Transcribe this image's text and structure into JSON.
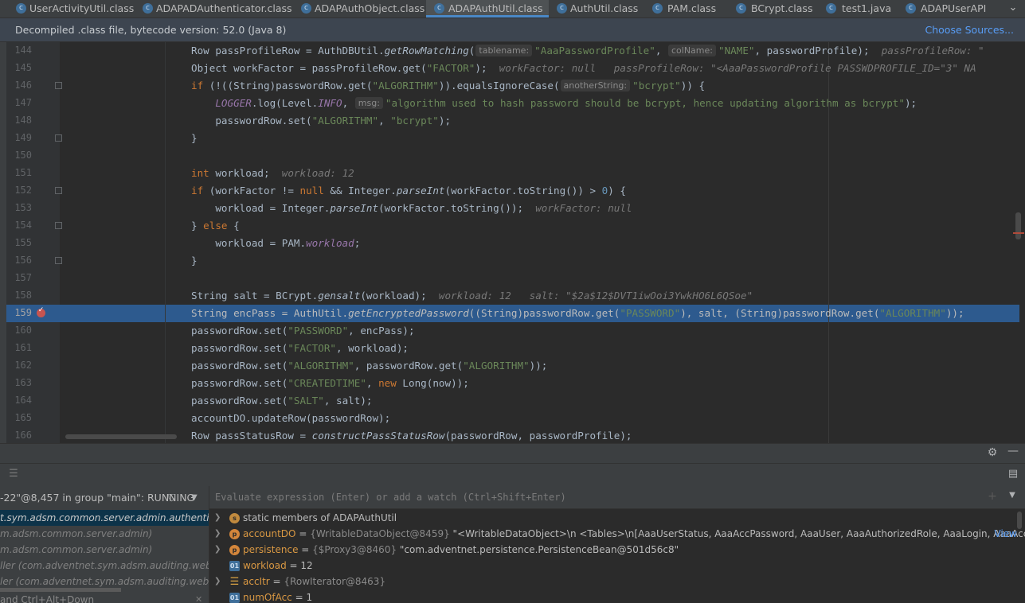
{
  "tabs": [
    {
      "label": "UserActivityUtil.class",
      "active": false
    },
    {
      "label": "ADAPADAuthenticator.class",
      "active": false
    },
    {
      "label": "ADAPAuthObject.class",
      "active": false
    },
    {
      "label": "ADAPAuthUtil.class",
      "active": true
    },
    {
      "label": "AuthUtil.class",
      "active": false
    },
    {
      "label": "PAM.class",
      "active": false
    },
    {
      "label": "BCrypt.class",
      "active": false
    },
    {
      "label": "test1.java",
      "active": false
    },
    {
      "label": "ADAPUserAPI",
      "active": false
    }
  ],
  "banner": {
    "text": "Decompiled .class file, bytecode version: 52.0 (Java 8)",
    "link": "Choose Sources..."
  },
  "editor": {
    "line_numbers": [
      "144",
      "145",
      "146",
      "147",
      "148",
      "149",
      "150",
      "151",
      "152",
      "153",
      "154",
      "155",
      "156",
      "157",
      "158",
      "159",
      "160",
      "161",
      "162",
      "163",
      "164",
      "165",
      "166"
    ],
    "current_line": "159",
    "param_hints": {
      "tablename": "tablename:",
      "colname": "colName:",
      "anotherstring": "anotherString:",
      "msg": "msg:"
    },
    "inline_values": {
      "l144": "passProfileRow: \"",
      "l145a": "workFactor: null",
      "l145b": "passProfileRow: \"<AaaPasswordProfile PASSWDPROFILE_ID=\"3\" NA",
      "l151": "workload: 12",
      "l153": "workFactor: null",
      "l158a": "workload: 12",
      "l158b": "salt: \"$2a$12$DVT1iwOoi3YwkHO6L6QSoe\""
    }
  },
  "debugger": {
    "thread_label": "-22\"@8,457 in group \"main\": RUNNING",
    "frames": [
      {
        "text": "t.sym.adsm.common.server.admin.authentication)",
        "selected": true
      },
      {
        "text": "m.adsm.common.server.admin)",
        "selected": false
      },
      {
        "text": "m.adsm.common.server.admin)",
        "selected": false
      },
      {
        "text": "ller (com.adventnet.sym.adsm.auditing.webclient.c",
        "selected": false
      },
      {
        "text": "ler (com.adventnet.sym.adsm.auditing.webclient.er",
        "selected": false
      },
      {
        "text": "and Ctrl+Alt+Down",
        "selected": false
      }
    ],
    "eval_placeholder": "Evaluate expression (Enter) or add a watch (Ctrl+Shift+Enter)",
    "variables": [
      {
        "name": "",
        "type": "",
        "value": "static members of ADAPAuthUtil",
        "icon": "s",
        "expandable": true,
        "prefix": ""
      },
      {
        "name": "accountDO",
        "type": "{WritableDataObject@8459}",
        "value": "\"<WritableDataObject>\\n <Tables>\\n[AaaUserStatus, AaaAccPassword, AaaUser, AaaAuthorizedRole, AaaLogin, AaaAccOwnerProfile, A...",
        "icon": "p",
        "expandable": true,
        "prefix": "View"
      },
      {
        "name": "persistence",
        "type": "{$Proxy3@8460}",
        "value": "\"com.adventnet.persistence.PersistenceBean@501d56c8\"",
        "icon": "p",
        "expandable": true,
        "prefix": ""
      },
      {
        "name": "workload",
        "type": "",
        "value": "12",
        "icon": "int",
        "expandable": false,
        "prefix": ""
      },
      {
        "name": "accItr",
        "type": "{RowIterator@8463}",
        "value": "",
        "icon": "list",
        "expandable": true,
        "prefix": ""
      },
      {
        "name": "numOfAcc",
        "type": "",
        "value": "1",
        "icon": "int",
        "expandable": false,
        "prefix": ""
      }
    ]
  },
  "colors": {
    "editor_bg": "#2b2b2b",
    "selection": "#2d5a8e",
    "keyword": "#cc7832",
    "string": "#6a8759",
    "number": "#6897bb",
    "breakpoint": "#c75450",
    "link": "#589df6"
  }
}
